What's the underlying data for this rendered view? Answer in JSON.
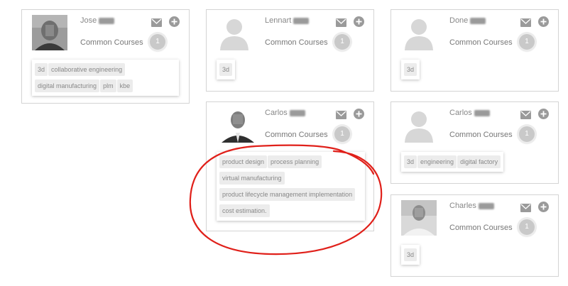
{
  "common_courses_label": "Common Courses",
  "colors": {
    "card_border": "#d4d4d4",
    "tag_bg": "#ececec",
    "badge_bg": "#c9c9c9",
    "annotation_red": "#e0201a"
  },
  "icons": {
    "mail": "mail-icon",
    "add": "plus-icon",
    "placeholder_avatar": "user-silhouette-icon"
  },
  "cards": [
    {
      "first_name": "Jose",
      "common_courses": "1",
      "tags": [
        "3d",
        "collaborative engineering",
        "digital manufacturing",
        "plm",
        "kbe"
      ]
    },
    {
      "first_name": "Lennart",
      "common_courses": "1",
      "tags": [
        "3d"
      ]
    },
    {
      "first_name": "Done",
      "common_courses": "1",
      "tags": [
        "3d"
      ]
    },
    {
      "first_name": "Carlos",
      "common_courses": "1",
      "tags": [
        "product design",
        "process planning",
        "virtual manufacturing",
        "product lifecycle management implementation",
        "cost estimation."
      ]
    },
    {
      "first_name": "Carlos",
      "common_courses": "1",
      "tags": [
        "3d",
        "engineering",
        "digital factory"
      ]
    },
    {
      "first_name": "Charles",
      "common_courses": "1",
      "tags": [
        "3d"
      ]
    }
  ]
}
